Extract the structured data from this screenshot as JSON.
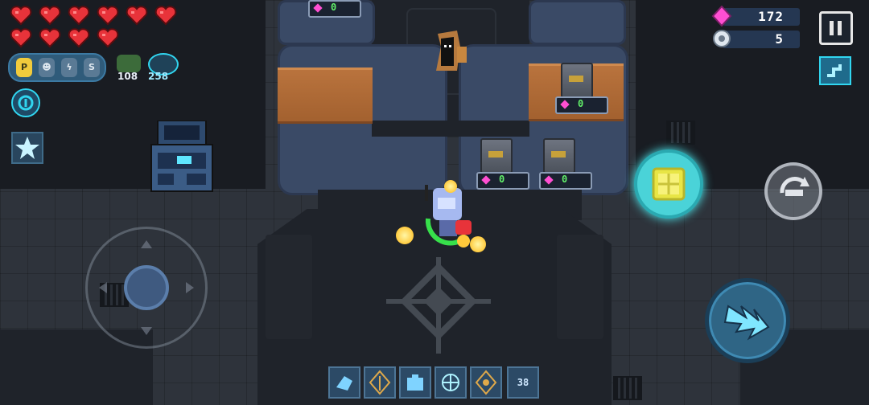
{
  "hud": {
    "hearts": {
      "count": 10,
      "color": "#e8333a"
    },
    "gems": {
      "value": "172",
      "icon": "pink-gem-icon",
      "color": "#ff4fd2"
    },
    "parts": {
      "value": "5",
      "icon": "gear-part-icon"
    },
    "pause_icon": "pause-icon",
    "minimap_icon": "minimap-icon"
  },
  "buffs": {
    "pills": [
      "P",
      "☻",
      "ϟ",
      "S"
    ],
    "stat_1": "108",
    "stat_2": "258"
  },
  "shop": {
    "counters": [
      "0",
      "0",
      "0",
      "0"
    ]
  },
  "controls": {
    "joystick": "virtual-joystick",
    "skill_button": "lightning-claw-skill-icon",
    "swap_weapon": "swap-weapon-icon",
    "interact": "treasure-chest-open-icon"
  },
  "hotbar": {
    "slots": [
      "hand-icon",
      "sword-buff-icon",
      "medkit-icon",
      "snowflake-icon",
      "spark-icon",
      "38"
    ],
    "counter_label": "38"
  },
  "colors": {
    "accent": "#31d6f0",
    "heart": "#e8333a",
    "counter_text": "#62f06a",
    "gem": "#ff4fd2"
  }
}
